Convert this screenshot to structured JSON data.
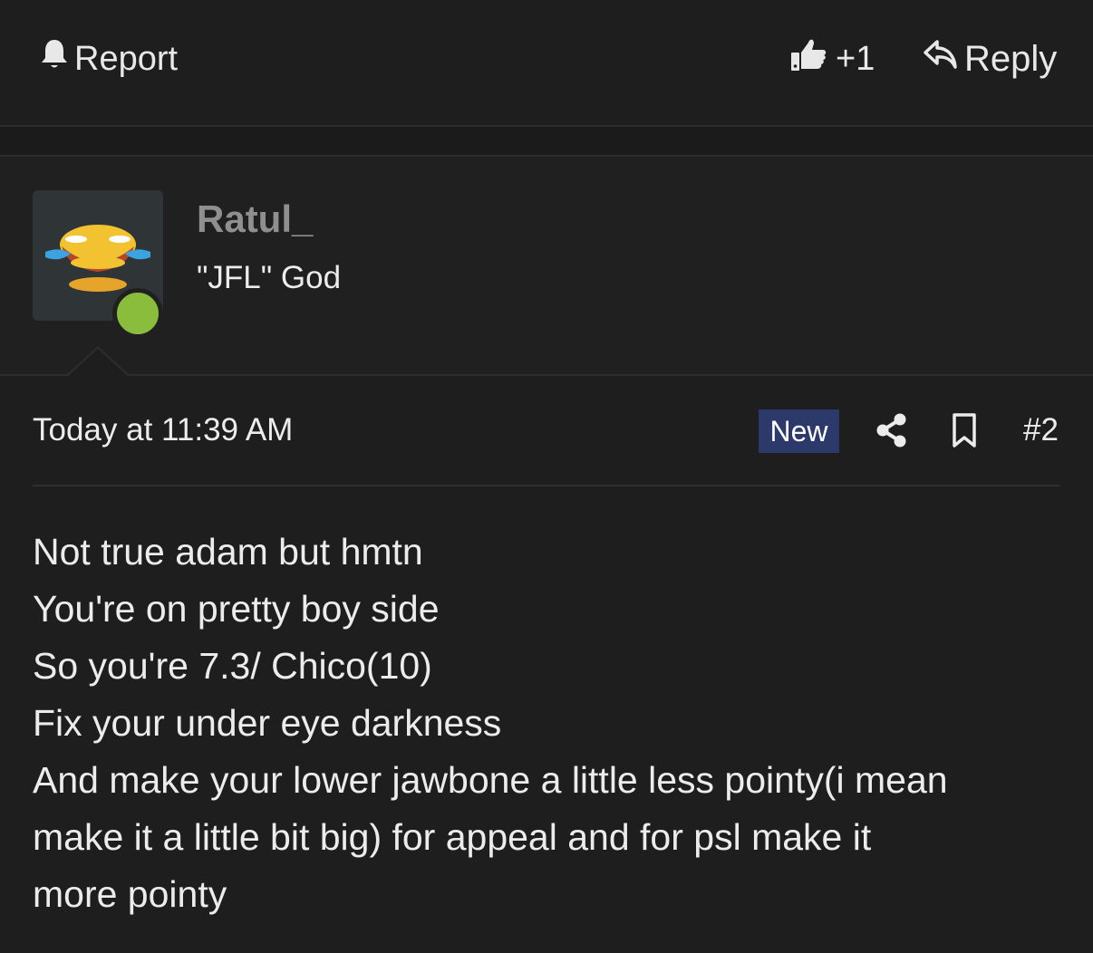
{
  "prev_post_actions": {
    "report_label": "Report",
    "like_label": "+1",
    "reply_label": "Reply"
  },
  "user": {
    "name": "Ratul_",
    "title": "\"JFL\" God",
    "status": "online"
  },
  "post": {
    "date": "Today at 11:39 AM",
    "badge": "New",
    "number": "#2",
    "body_lines": [
      "Not true adam but hmtn",
      "You're on pretty boy side",
      "So you're 7.3/ Chico(10)",
      "Fix your under eye darkness",
      "And make your lower jawbone a little less pointy(i mean",
      "make it a little bit big) for appeal and for psl make it",
      "more pointy"
    ]
  },
  "colors": {
    "background": "#1e1e1e",
    "new_badge": "#2b3a6b",
    "online": "#8bbd3c",
    "username": "#8f8f8f"
  },
  "icons": [
    "bell-icon",
    "thumbs-up-icon",
    "reply-arrow-icon",
    "share-icon",
    "bookmark-icon"
  ]
}
